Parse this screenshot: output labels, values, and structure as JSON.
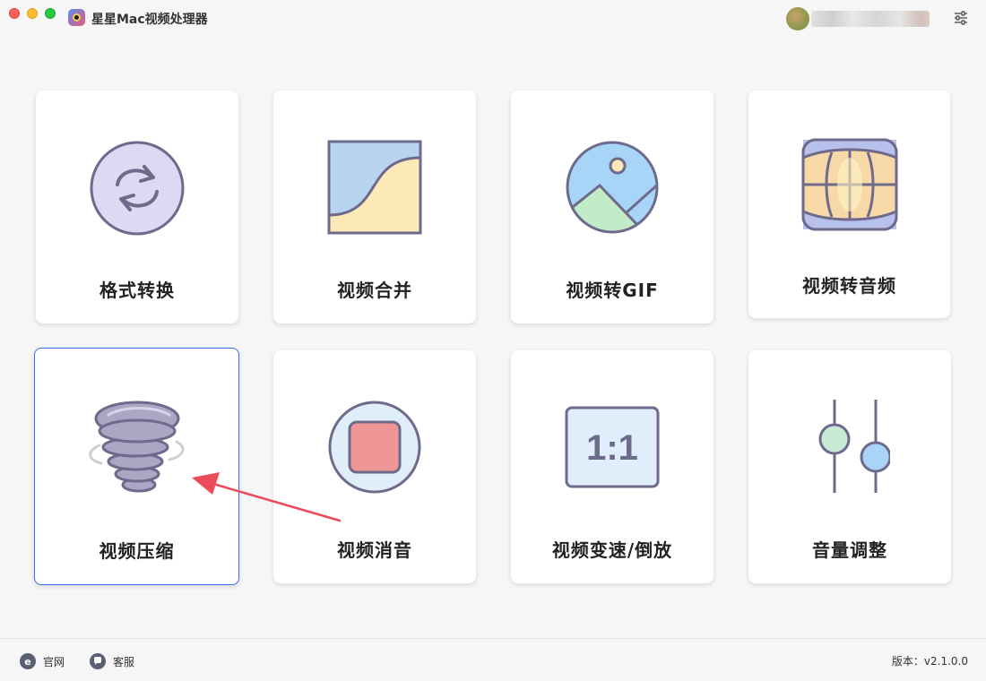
{
  "window": {
    "title": "星星Mac视频处理器"
  },
  "header": {
    "settings_icon": "sliders-icon"
  },
  "cards": [
    {
      "label": "格式转换",
      "icon": "convert-arrows-icon"
    },
    {
      "label": "视频合并",
      "icon": "merge-image-icon"
    },
    {
      "label": "视频转GIF",
      "icon": "gif-picture-icon"
    },
    {
      "label": "视频转音频",
      "icon": "audio-globe-icon"
    },
    {
      "label": "视频压缩",
      "icon": "tornado-compress-icon",
      "selected": true
    },
    {
      "label": "视频消音",
      "icon": "stop-mute-icon"
    },
    {
      "label": "视频变速/倒放",
      "icon": "ratio-speed-icon"
    },
    {
      "label": "音量调整",
      "icon": "volume-sliders-icon"
    }
  ],
  "card_icons": {
    "ratio_text": "1:1"
  },
  "footer": {
    "website_label": "官网",
    "website_icon_glyph": "e",
    "support_label": "客服",
    "version_text": "版本：v2.1.0.0"
  },
  "colors": {
    "accent": "#3a6df0",
    "icon_stroke": "#6e6a8c",
    "annotation_arrow": "#ec4b5a"
  }
}
